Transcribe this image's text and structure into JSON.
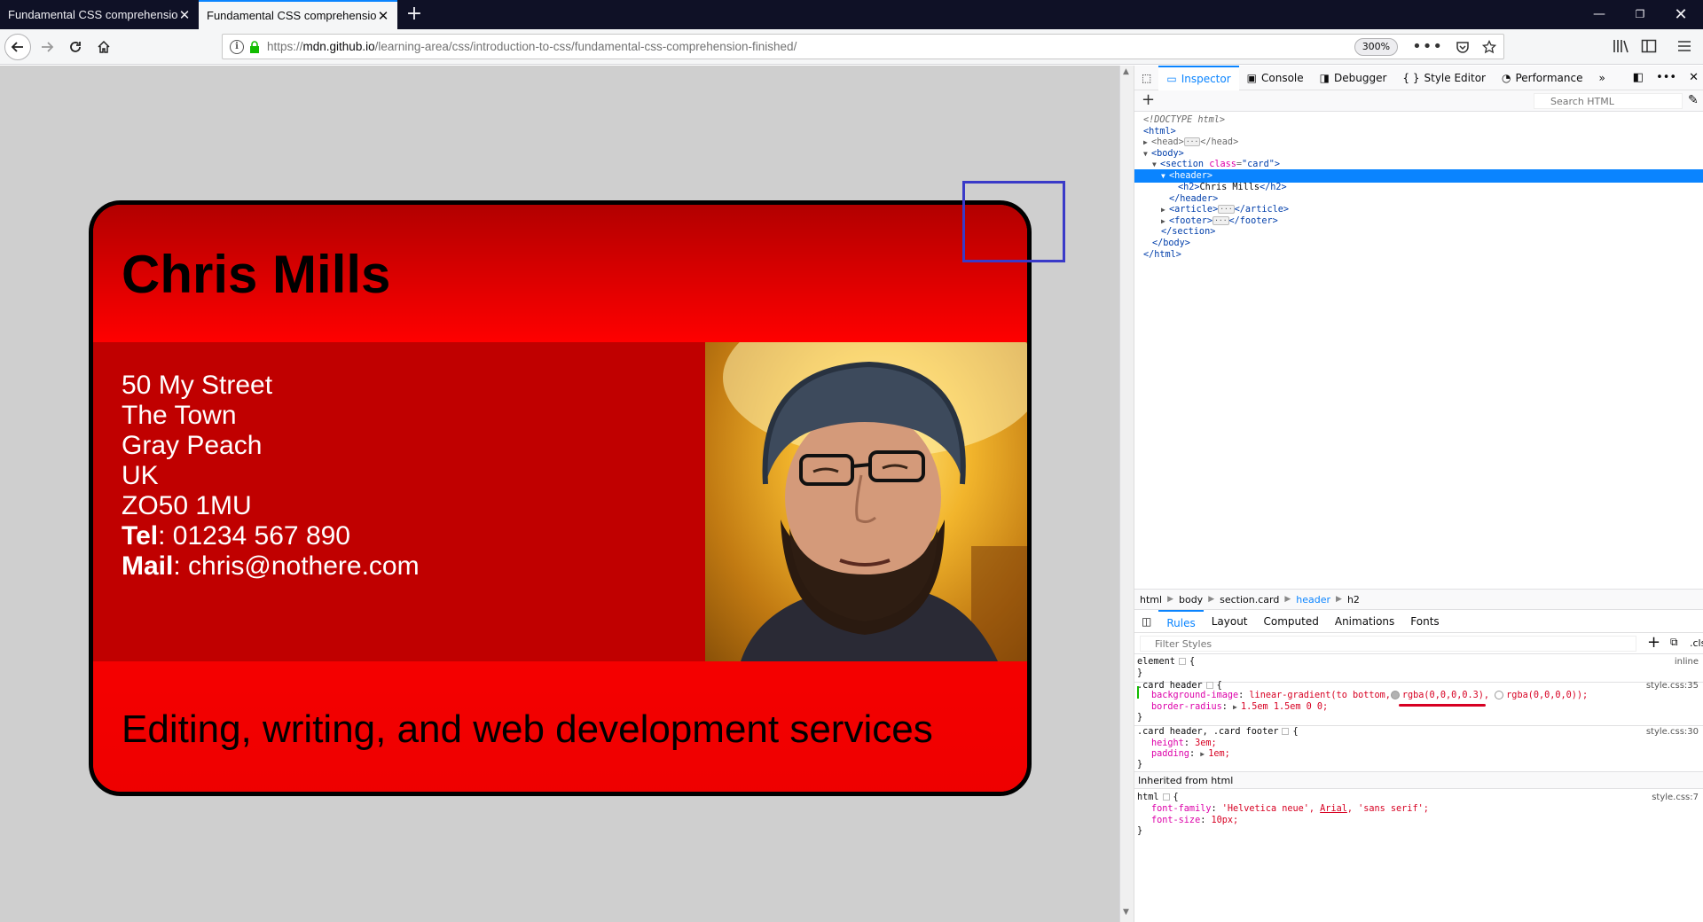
{
  "tabs": [
    {
      "title": "Fundamental CSS comprehension",
      "active": false
    },
    {
      "title": "Fundamental CSS comprehension",
      "active": true
    }
  ],
  "url": {
    "prefix": "https://",
    "host": "mdn.github.io",
    "path": "/learning-area/css/introduction-to-css/fundamental-css-comprehension-finished/"
  },
  "zoom": "300%",
  "card": {
    "name": "Chris Mills",
    "address": [
      "50 My Street",
      "The Town",
      "Gray Peach",
      "UK",
      "ZO50 1MU"
    ],
    "tel_label": "Tel",
    "tel_value": ": 01234 567 890",
    "mail_label": "Mail",
    "mail_value": ": chris@nothere.com",
    "tagline": "Editing, writing, and web development services"
  },
  "devtools": {
    "tabs": [
      "Inspector",
      "Console",
      "Debugger",
      "Style Editor",
      "Performance"
    ],
    "search_placeholder": "Search HTML",
    "markup": {
      "doctype": "<!DOCTYPE html>",
      "html_open": "<html>",
      "head": "<head>",
      "head_close": "</head>",
      "body_open": "<body>",
      "section_tag": "<section",
      "section_attr": "class",
      "section_val": "\"card\"",
      "section_close_bracket": ">",
      "header_open": "<header>",
      "h2_open": "<h2>",
      "h2_text": "Chris Mills",
      "h2_close": "</h2>",
      "header_close": "</header>",
      "article": "<article>",
      "article_close": "</article>",
      "footer": "<footer>",
      "footer_close": "</footer>",
      "section_close": "</section>",
      "body_close": "</body>",
      "html_close": "</html>"
    },
    "breadcrumbs": [
      "html",
      "body",
      "section.card",
      "header",
      "h2"
    ],
    "rules_tabs": [
      "Rules",
      "Layout",
      "Computed",
      "Animations",
      "Fonts"
    ],
    "filter_placeholder": "Filter Styles",
    "add_rule": "+",
    "cls": ".cls",
    "rules": {
      "element_selector": "element",
      "element_source": "inline",
      "r1_selector": ".card header",
      "r1_source": "style.css:35",
      "r1_p1": "background-image",
      "r1_p1_v1": "linear-gradient(to bottom,",
      "r1_p1_v2": "rgba(0,0,0,0.3),",
      "r1_p1_v3": "rgba(0,0,0,0));",
      "r1_p2": "border-radius",
      "r1_p2_v": "1.5em 1.5em 0 0;",
      "r2_selector": ".card header, .card footer",
      "r2_source": "style.css:30",
      "r2_p1": "height",
      "r2_p1_v": "3em;",
      "r2_p2": "padding",
      "r2_p2_v": "1em;",
      "inherited": "Inherited from html",
      "r3_selector": "html",
      "r3_source": "style.css:7",
      "r3_p1": "font-family",
      "r3_p1_v1": "'Helvetica neue',",
      "r3_p1_v2": "Arial",
      "r3_p1_v3": ", 'sans serif';",
      "r3_p2": "font-size",
      "r3_p2_v": "10px;"
    }
  }
}
